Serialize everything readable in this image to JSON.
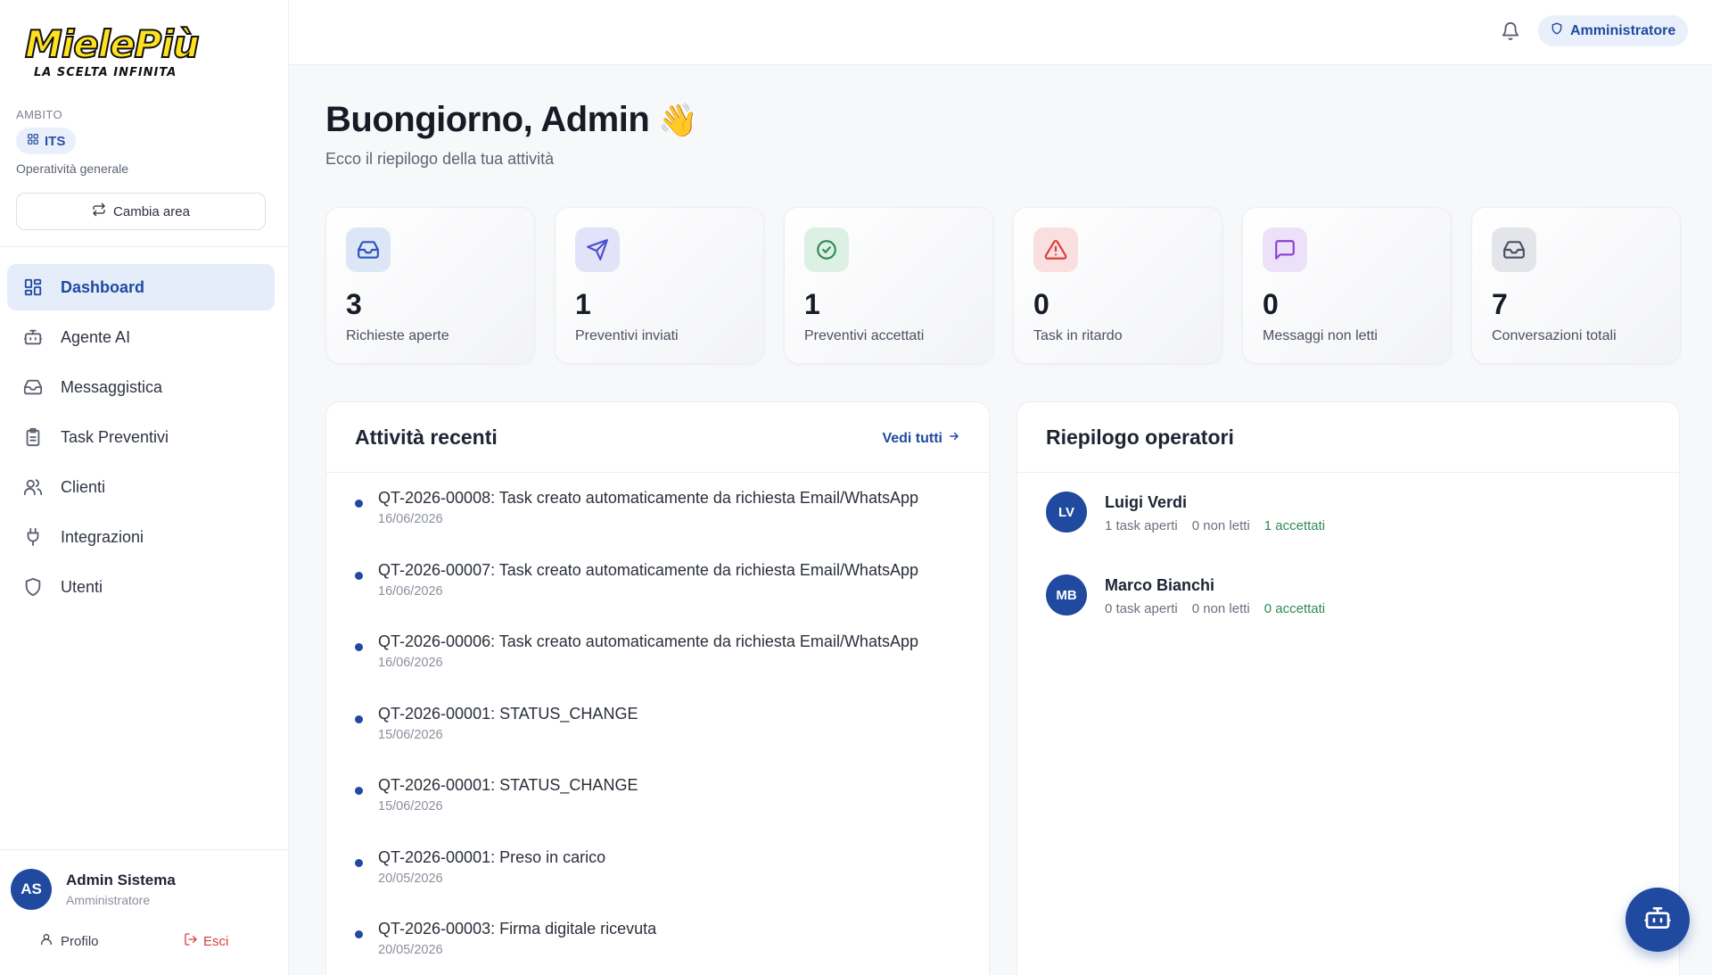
{
  "brand": {
    "logo_text": "MielePiù",
    "logo_tagline": "LA SCELTA INFINITA"
  },
  "sidebar": {
    "ambito_label": "AMBITO",
    "ambito_value": "ITS",
    "ambito_desc": "Operatività generale",
    "cambia_label": "Cambia area",
    "items": [
      {
        "label": "Dashboard",
        "icon": "dashboard-icon",
        "active": true
      },
      {
        "label": "Agente AI",
        "icon": "bot-icon"
      },
      {
        "label": "Messaggistica",
        "icon": "inbox-icon"
      },
      {
        "label": "Task Preventivi",
        "icon": "clipboard-icon"
      },
      {
        "label": "Clienti",
        "icon": "users-icon"
      },
      {
        "label": "Integrazioni",
        "icon": "plug-icon"
      },
      {
        "label": "Utenti",
        "icon": "shield-icon"
      }
    ],
    "user": {
      "initials": "AS",
      "name": "Admin Sistema",
      "role": "Amministratore",
      "profile_label": "Profilo",
      "logout_label": "Esci"
    }
  },
  "topbar": {
    "role_label": "Amministratore"
  },
  "greeting": {
    "title": "Buongiorno, Admin",
    "emoji": "👋",
    "subtitle": "Ecco il riepilogo della tua attività"
  },
  "stats": [
    {
      "value": "3",
      "label": "Richieste aperte",
      "icon": "inbox-icon",
      "color": "#2b56b8",
      "bg": "#dde6f7"
    },
    {
      "value": "1",
      "label": "Preventivi inviati",
      "icon": "send-icon",
      "color": "#4b4fd0",
      "bg": "#e2e3f9"
    },
    {
      "value": "1",
      "label": "Preventivi accettati",
      "icon": "check-circle-icon",
      "color": "#2f8a55",
      "bg": "#dcf1e4"
    },
    {
      "value": "0",
      "label": "Task in ritardo",
      "icon": "alert-triangle-icon",
      "color": "#d93c3c",
      "bg": "#f9dfdf"
    },
    {
      "value": "0",
      "label": "Messaggi non letti",
      "icon": "message-icon",
      "color": "#8b3fd4",
      "bg": "#ece1f9"
    },
    {
      "value": "7",
      "label": "Conversazioni totali",
      "icon": "inbox-icon",
      "color": "#4a5160",
      "bg": "#e3e5ea"
    }
  ],
  "activity": {
    "title": "Attività recenti",
    "see_all": "Vedi tutti",
    "items": [
      {
        "text": "QT-2026-00008: Task creato automaticamente da richiesta Email/WhatsApp",
        "date": "16/06/2026"
      },
      {
        "text": "QT-2026-00007: Task creato automaticamente da richiesta Email/WhatsApp",
        "date": "16/06/2026"
      },
      {
        "text": "QT-2026-00006: Task creato automaticamente da richiesta Email/WhatsApp",
        "date": "16/06/2026"
      },
      {
        "text": "QT-2026-00001: STATUS_CHANGE",
        "date": "15/06/2026"
      },
      {
        "text": "QT-2026-00001: STATUS_CHANGE",
        "date": "15/06/2026"
      },
      {
        "text": "QT-2026-00001: Preso in carico",
        "date": "20/05/2026"
      },
      {
        "text": "QT-2026-00003: Firma digitale ricevuta",
        "date": "20/05/2026"
      }
    ]
  },
  "operators": {
    "title": "Riepilogo operatori",
    "items": [
      {
        "initials": "LV",
        "name": "Luigi Verdi",
        "open": "1 task aperti",
        "unread": "0 non letti",
        "accepted": "1 accettati"
      },
      {
        "initials": "MB",
        "name": "Marco Bianchi",
        "open": "0 task aperti",
        "unread": "0 non letti",
        "accepted": "0 accettati"
      }
    ]
  }
}
